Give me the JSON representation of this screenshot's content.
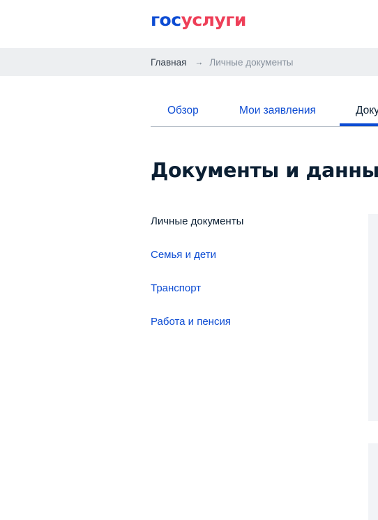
{
  "header": {
    "logo_part1": "гос",
    "logo_part2": "услуги"
  },
  "breadcrumbs": {
    "home": "Главная",
    "arrow": "→",
    "current": "Личные документы"
  },
  "tabs": [
    {
      "label": "Обзор"
    },
    {
      "label": "Мои заявления"
    },
    {
      "label": "Доку"
    }
  ],
  "page_title": "Документы и данные",
  "side_nav": [
    {
      "label": "Личные документы",
      "active": true
    },
    {
      "label": "Семья и дети"
    },
    {
      "label": "Транспорт"
    },
    {
      "label": "Работа и пенсия"
    }
  ],
  "colors": {
    "brand_blue": "#0d4cd3",
    "brand_red": "#ee3f58",
    "text_dark": "#0b1f33",
    "breadcrumb_bg": "#edeff1"
  }
}
